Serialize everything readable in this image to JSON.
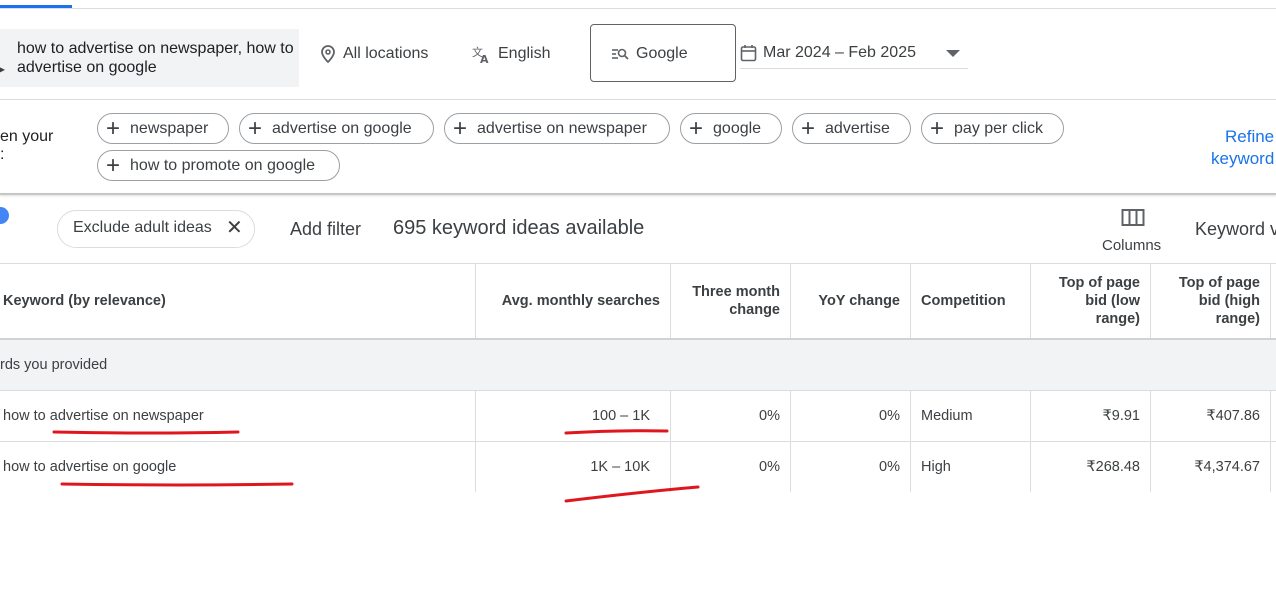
{
  "search": {
    "query": "how to advertise on newspaper, how to advertise on google",
    "location": "All locations",
    "language": "English",
    "network": "Google",
    "date_range": "Mar 2024 – Feb 2025"
  },
  "broaden": {
    "label_line1": "en your",
    "label_line2": ":",
    "chips": [
      "newspaper",
      "advertise on google",
      "advertise on newspaper",
      "google",
      "advertise",
      "pay per click",
      "how to promote on google"
    ],
    "refine_line1": "Refine",
    "refine_line2": "keyword"
  },
  "filters": {
    "exclude_adult": "Exclude adult ideas",
    "add_filter": "Add filter",
    "ideas_count": "695 keyword ideas available",
    "columns": "Columns",
    "keyword_view": "Keyword v"
  },
  "table": {
    "headers": {
      "keyword": "Keyword (by relevance)",
      "avg_searches": "Avg. monthly searches",
      "three_month": "Three month change",
      "yoy": "YoY change",
      "competition": "Competition",
      "bid_low": "Top of page bid (low range)",
      "bid_high": "Top of page bid (high range)"
    },
    "group_label": "rds you provided",
    "rows": [
      {
        "keyword": "how to advertise on newspaper",
        "avg_searches": "100 – 1K",
        "three_month": "0%",
        "yoy": "0%",
        "competition": "Medium",
        "bid_low": "₹9.91",
        "bid_high": "₹407.86"
      },
      {
        "keyword": "how to advertise on google",
        "avg_searches": "1K – 10K",
        "three_month": "0%",
        "yoy": "0%",
        "competition": "High",
        "bid_low": "₹268.48",
        "bid_high": "₹4,374.67"
      }
    ]
  },
  "colors": {
    "accent": "#1a73e8",
    "annotation": "#e0161e",
    "group_bg": "#f1f3f4"
  }
}
